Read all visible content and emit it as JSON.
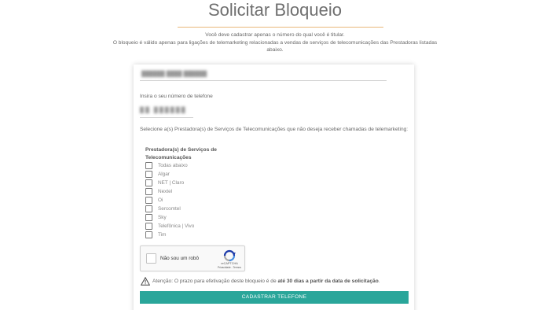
{
  "header": {
    "title": "Solicitar Bloqueio",
    "intro_line1": "Você deve cadastrar apenas o número do qual você é titular.",
    "intro_line2": "O bloqueio é válido apenas para ligações de telemarketing relacionadas a vendas de serviços de telecomunicações das Prestadoras listadas abaixo."
  },
  "form": {
    "name_value": "██████ ████ ██████",
    "phone_label": "Insira o seu número de telefone",
    "phone_value": "██ ██████",
    "select_label": "Selecione a(s) Prestadora(s) de Serviços de Telecomunicações que não deseja receber chamadas de telemarketing:",
    "list_header": "Prestadora(s) de Serviços de Telecomunicações",
    "options": [
      "Todas abaixo",
      "Algar",
      "NET | Claro",
      "Nextel",
      "Oi",
      "Sercomtel",
      "Sky",
      "Telefônica | Vivo",
      "Tim"
    ],
    "recaptcha": {
      "label": "Não sou um robô",
      "brand": "reCAPTCHA",
      "links": "Privacidade - Termos"
    },
    "warning": {
      "prefix": "Atenção: O prazo para efetivação deste bloqueio é de ",
      "bold": "até 30 dias a partir da data de solicitação",
      "suffix": "."
    },
    "submit_label": "CADASTRAR TELEFONE"
  },
  "colors": {
    "accent": "#2aa69a",
    "underline": "#e9b77a"
  }
}
